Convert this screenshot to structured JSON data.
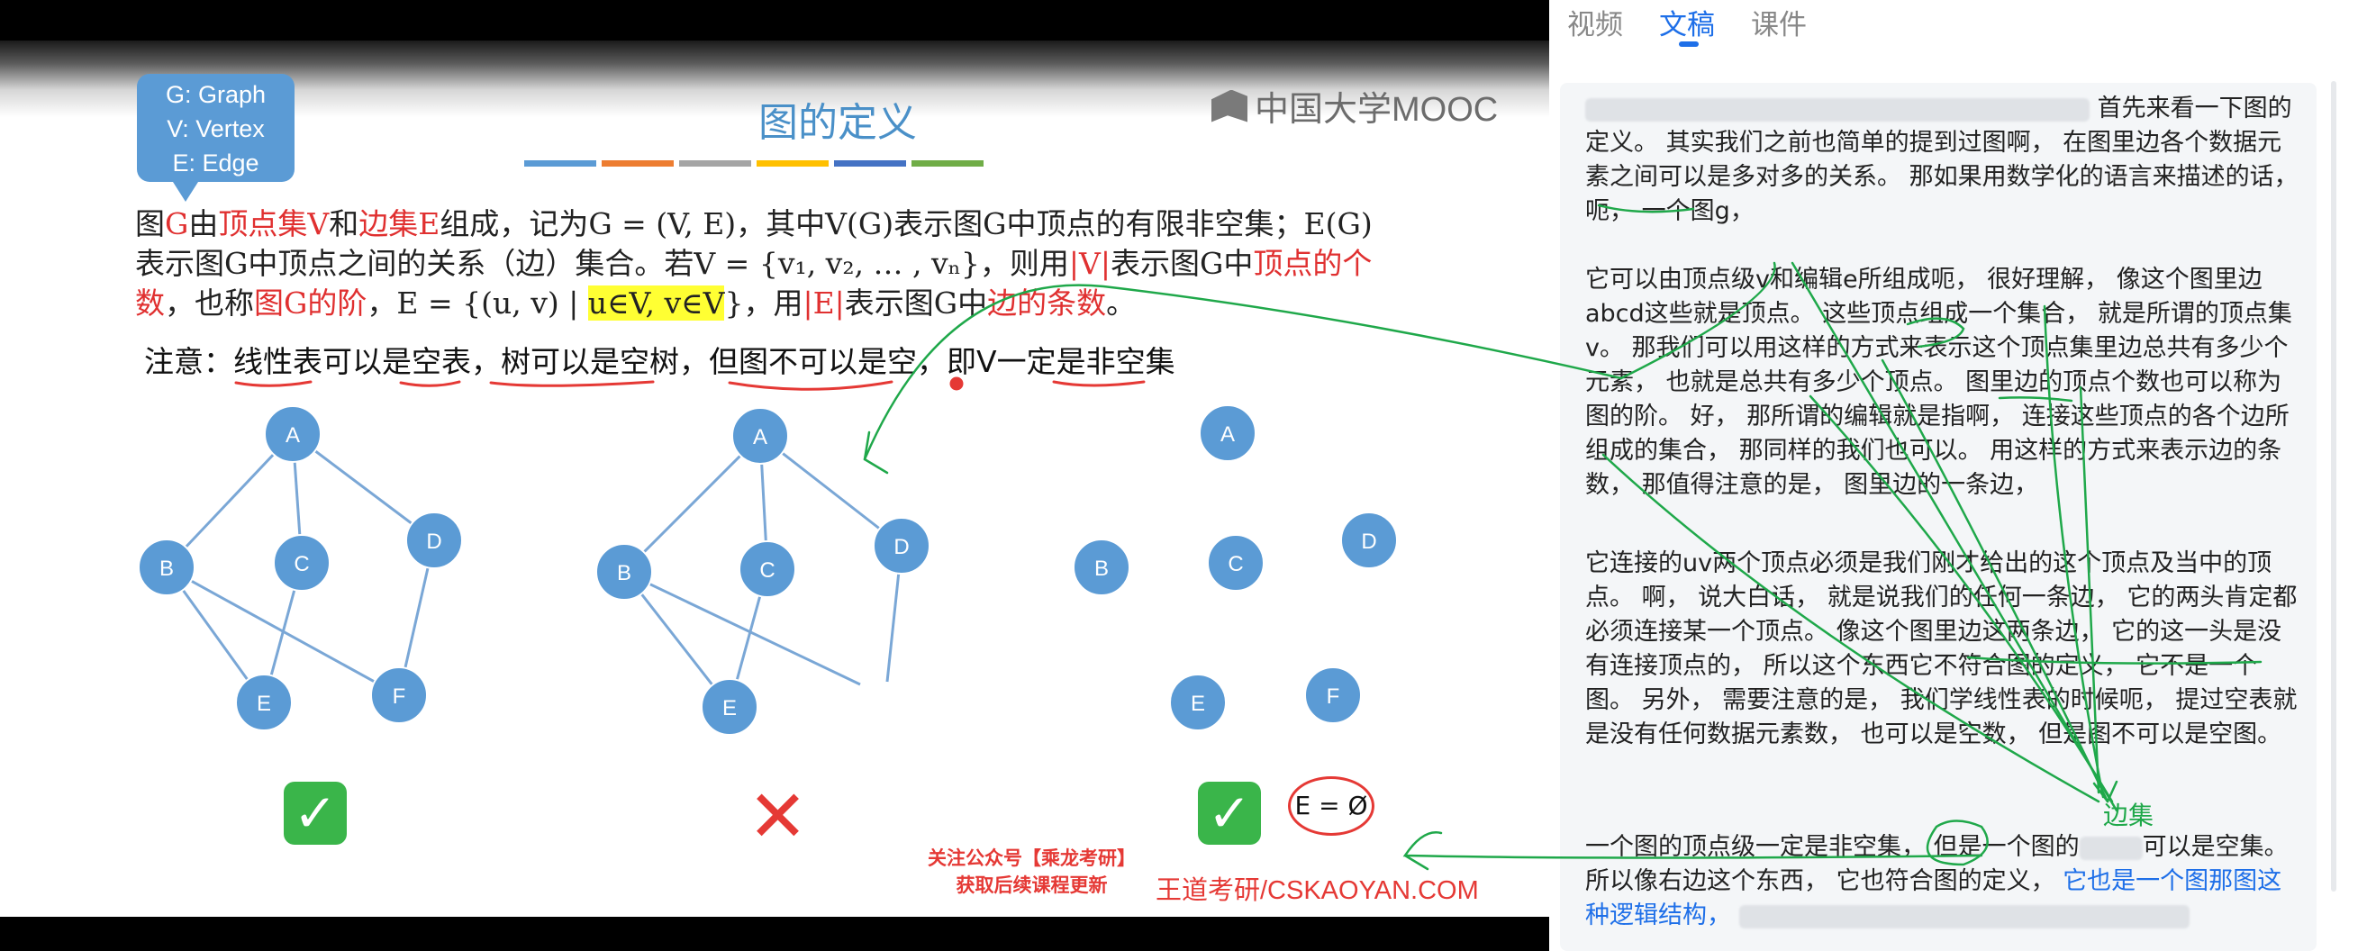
{
  "slide": {
    "callout_lines": [
      "G: Graph",
      "V: Vertex",
      "E: Edge"
    ],
    "title": "图的定义",
    "title_bar_colors": [
      "#5b9bd5",
      "#ed7d31",
      "#a5a5a5",
      "#ffc000",
      "#4472c4",
      "#70ad47"
    ],
    "logo_text": "中国大学MOOC",
    "definition_lines": [
      [
        {
          "t": "图"
        },
        {
          "t": "G",
          "c": "red"
        },
        {
          "t": "由"
        },
        {
          "t": "顶点集",
          "c": "red"
        },
        {
          "t": "V",
          "c": "red"
        },
        {
          "t": "和"
        },
        {
          "t": "边集",
          "c": "red"
        },
        {
          "t": "E",
          "c": "red"
        },
        {
          "t": "组成，记为G = (V, E)，其中V(G)表示图G中顶点的有限非空集；E(G)"
        }
      ],
      [
        {
          "t": "表示图G中顶点之间的关系（边）集合。若V = {v₁, v₂, … , vₙ}，则用"
        },
        {
          "t": "|V|",
          "c": "red"
        },
        {
          "t": "表示图G中"
        },
        {
          "t": "顶点的个",
          "c": "red"
        }
      ],
      [
        {
          "t": "数",
          "c": "red"
        },
        {
          "t": "，也称"
        },
        {
          "t": "图G的阶",
          "c": "red"
        },
        {
          "t": "，E = {(u, v) | "
        },
        {
          "t": "u∈V, v∈V",
          "c": "hl"
        },
        {
          "t": "}，用"
        },
        {
          "t": "|E|",
          "c": "red"
        },
        {
          "t": "表示图G中"
        },
        {
          "t": "边的条数",
          "c": "red"
        },
        {
          "t": "。"
        }
      ]
    ],
    "note_text": "注意：线性表可以是空表，树可以是空树，但图不可以是空，即V一定是非空集",
    "graphs": [
      {
        "nodes": [
          "A",
          "B",
          "C",
          "D",
          "E",
          "F"
        ]
      },
      {
        "nodes": [
          "A",
          "B",
          "C",
          "D",
          "E"
        ]
      },
      {
        "nodes": [
          "A",
          "B",
          "C",
          "D",
          "E",
          "F"
        ]
      }
    ],
    "verdicts": [
      "✓",
      "✕",
      "✓"
    ],
    "empty_set_label": "E = Ø",
    "wechat_lines": [
      "关注公众号【乘龙考研】",
      "获取后续课程更新"
    ],
    "watermark": "王道考研/CSKAOYAN.COM"
  },
  "panel": {
    "tabs": [
      "视频",
      "文稿",
      "课件"
    ],
    "active_tab": "文稿",
    "annotation_label": "边集",
    "paragraphs": [
      "首先来看一下图的定义。 其实我们之前也简单的提到过图啊， 在图里边各个数据元素之间可以是多对多的关系。 那如果用数学化的语言来描述的话， 呃， 一个图g，",
      "它可以由顶点级v和编辑e所组成呃， 很好理解， 像这个图里边abcd这些就是顶点。 这些顶点组成一个集合， 就是所谓的顶点集v。 那我们可以用这样的方式来表示这个顶点集里边总共有多少个元素， 也就是总共有多少个顶点。 图里边的顶点个数也可以称为图的阶。 好， 那所谓的编辑就是指啊， 连接这些顶点的各个边所组成的集合， 那同样的我们也可以。 用这样的方式来表示边的条数， 那值得注意的是， 图里边的一条边，",
      "它连接的uv两个顶点必须是我们刚才给出的这个顶点及当中的顶点。 啊， 说大白话， 就是说我们的任何一条边， 它的两头肯定都必须连接某一个顶点。 像这个图里边这两条边， 它的这一头是没有连接顶点的， 所以这个东西它不符合图的定义， 它不是一个图。 另外， 需要注意的是， 我们学线性表的时候呃， 提过空表就是没有任何数据元素数， 也可以是空数， 但是图不可以是空图。",
      "一个图的顶点级一定是非空集， 但是一个图的",
      "可以是空集。 所以像右边这个东西， 它也符合图的定义，",
      "它也是一个图那图这种逻辑结构，"
    ]
  }
}
